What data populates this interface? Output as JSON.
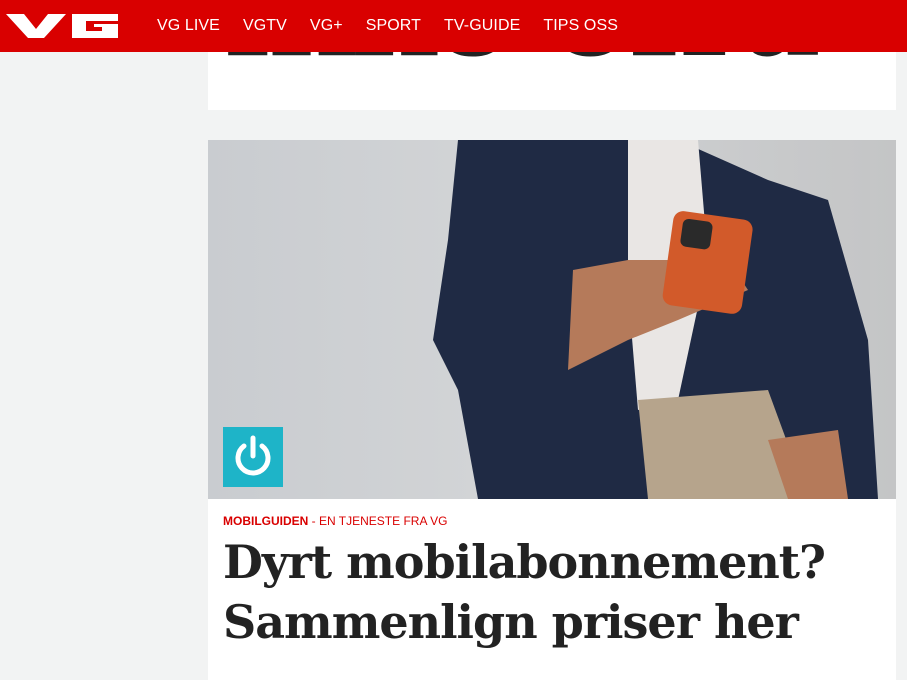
{
  "header": {
    "logo": "VG",
    "nav": [
      "VG LIVE",
      "VGTV",
      "VG+",
      "SPORT",
      "TV-GUIDE",
      "TIPS OSS"
    ],
    "color": "#d90000"
  },
  "previous_article": {
    "headline_fragment": "ikke ofra"
  },
  "article": {
    "kicker_brand": "MOBILGUIDEN",
    "kicker_rest": " - EN TJENESTE FRA VG",
    "title": "Dyrt mobilabonnement? Sammenlign priser her",
    "badge_icon": "power-icon",
    "badge_color": "#1eb4c8"
  }
}
